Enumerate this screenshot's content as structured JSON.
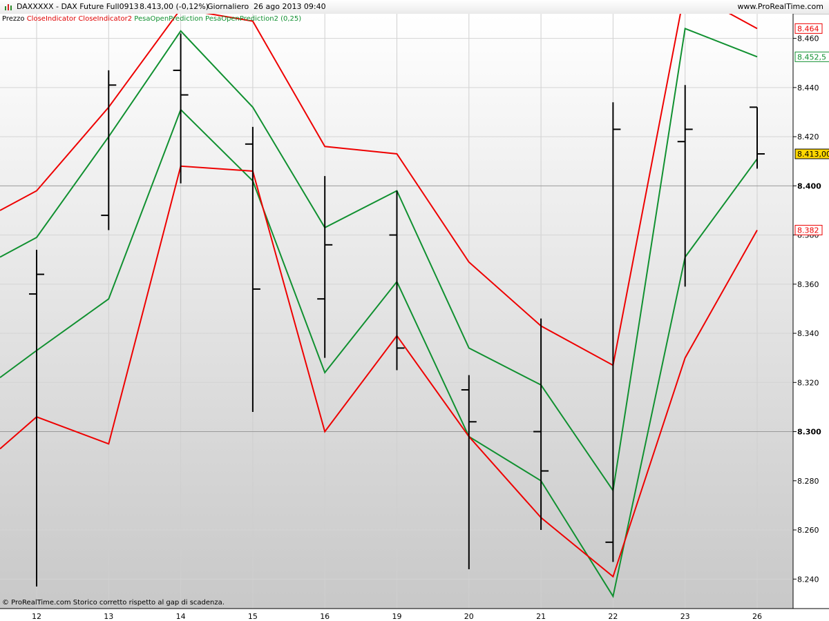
{
  "header": {
    "instrument": "DAXXXXX - DAX Future Full0913",
    "quote": "8.413,00 (-0,12%)",
    "period": "Giornaliero",
    "datetime": "26 ago 2013 09:40",
    "site": "www.ProRealTime.com",
    "icon": "bar-chart-icon"
  },
  "legend": {
    "price": "Prezzo",
    "close_indicators": "CloseIndicator CloseIndicator2",
    "pesa_indicators": "PesaOpenPrediction PesaOpenPrediction2 (0,25)"
  },
  "footer_note": "© ProRealTime.com  Storico corretto rispetto al gap di scadenza.",
  "colors": {
    "red": "#ee0000",
    "green": "#109030",
    "bars": "#000000",
    "current_label": "#ffd700"
  },
  "chart_data": {
    "type": "line",
    "categories": [
      "12",
      "13",
      "14",
      "15",
      "16",
      "19",
      "20",
      "21",
      "22",
      "23",
      "26"
    ],
    "ylim": [
      8228,
      8470
    ],
    "y_ticks": [
      8240,
      8260,
      8280,
      8300,
      8320,
      8340,
      8360,
      8380,
      8400,
      8420,
      8440,
      8460
    ],
    "y_tick_labels": [
      "8.240",
      "8.260",
      "8.280",
      "8.300",
      "8.320",
      "8.340",
      "8.360",
      "8.380",
      "8.400",
      "8.420",
      "8.440",
      "8.460"
    ],
    "major_ticks": [
      8300,
      8400
    ],
    "grid": true,
    "ohlc": [
      {
        "x": "12",
        "open": 8356,
        "high": 8374,
        "low": 8237,
        "close": 8364
      },
      {
        "x": "13",
        "open": 8388,
        "high": 8447,
        "low": 8382,
        "close": 8441
      },
      {
        "x": "14",
        "open": 8447,
        "high": 8462,
        "low": 8401,
        "close": 8437
      },
      {
        "x": "15",
        "open": 8417,
        "high": 8424,
        "low": 8308,
        "close": 8358
      },
      {
        "x": "16",
        "open": 8354,
        "high": 8404,
        "low": 8330,
        "close": 8376
      },
      {
        "x": "19",
        "open": 8380,
        "high": 8398,
        "low": 8325,
        "close": 8334
      },
      {
        "x": "20",
        "open": 8317,
        "high": 8323,
        "low": 8244,
        "close": 8304
      },
      {
        "x": "21",
        "open": 8300,
        "high": 8346,
        "low": 8260,
        "close": 8284
      },
      {
        "x": "22",
        "open": 8255,
        "high": 8434,
        "low": 8247,
        "close": 8423
      },
      {
        "x": "23",
        "open": 8418,
        "high": 8441,
        "low": 8359,
        "close": 8423
      },
      {
        "x": "26",
        "open": 8432,
        "high": 8432,
        "low": 8407,
        "close": 8413
      }
    ],
    "series": [
      {
        "color": "#ee0000",
        "values": [
          8398,
          8432,
          8472,
          8467,
          8416,
          8413,
          8369,
          8343,
          8327,
          8480,
          8464
        ]
      },
      {
        "color": "#109030",
        "values": [
          8379,
          8420,
          8463,
          8432,
          8383,
          8398,
          8334,
          8319,
          8276,
          8464,
          8452.5
        ]
      },
      {
        "color": "#109030",
        "values": [
          8333,
          8354,
          8431,
          8402,
          8324,
          8361,
          8298,
          8280,
          8233,
          8371,
          8411
        ]
      },
      {
        "color": "#ee0000",
        "values": [
          8306,
          8295,
          8408,
          8406,
          8300,
          8339,
          8298,
          8265,
          8241,
          8330,
          8382
        ]
      }
    ],
    "left_edge_values": [
      8390,
      8371,
      8322,
      8293
    ],
    "price_labels": [
      {
        "value": 8464,
        "text": "8.464",
        "color": "#ee0000"
      },
      {
        "value": 8452.5,
        "text": "8.452,5",
        "color": "#109030"
      },
      {
        "value": 8413,
        "text": "8.413,00",
        "color": "#000000",
        "bg": "#ffd700"
      },
      {
        "value": 8382,
        "text": "8.382",
        "color": "#ee0000"
      }
    ]
  }
}
